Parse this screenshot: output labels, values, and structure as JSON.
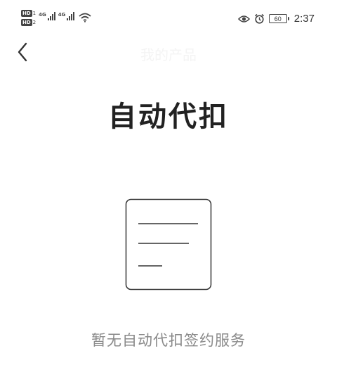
{
  "status_bar": {
    "sim1_badge": "HD",
    "sim1_num": "1",
    "sim2_badge": "HD",
    "sim2_num": "2",
    "signal1_label": "4G",
    "signal2_label": "4G",
    "wifi_icon": "wifi-icon",
    "eye_icon": "eye-icon",
    "alarm_icon": "alarm-icon",
    "battery_level": "60",
    "time": "2:37"
  },
  "header": {
    "back_icon": "chevron-left-icon",
    "nav_title": "我的产品"
  },
  "main": {
    "title": "自动代扣",
    "empty_icon": "document-lines-icon",
    "empty_text": "暂无自动代扣签约服务"
  },
  "colors": {
    "background": "#ffffff",
    "title": "#222222",
    "empty_text": "#8a8a8a",
    "icon_stroke": "#333333"
  }
}
